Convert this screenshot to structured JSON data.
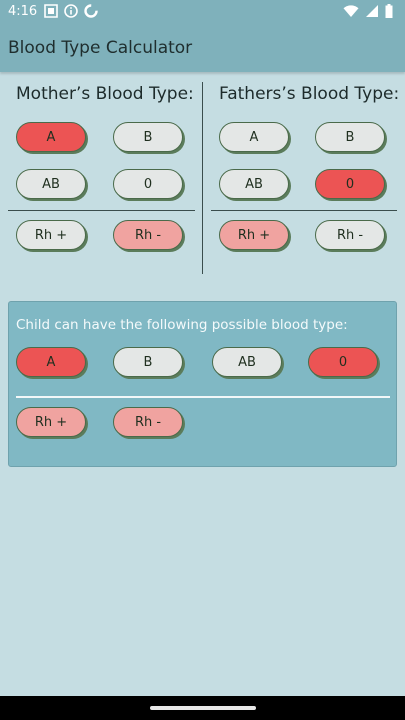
{
  "status_bar": {
    "time": "4:16",
    "icons": [
      "system-icon",
      "info-icon",
      "data-saver-icon",
      "wifi-icon",
      "signal-icon",
      "battery-icon"
    ]
  },
  "app_bar": {
    "title": "Blood Type Calculator"
  },
  "mother": {
    "heading": "Mother’s Blood Type:",
    "types": [
      {
        "label": "A",
        "state": "selected"
      },
      {
        "label": "B",
        "state": "unselected"
      },
      {
        "label": "AB",
        "state": "unselected"
      },
      {
        "label": "0",
        "state": "unselected"
      }
    ],
    "rh": [
      {
        "label": "Rh +",
        "state": "unselected"
      },
      {
        "label": "Rh -",
        "state": "selected"
      }
    ]
  },
  "father": {
    "heading": "Fathers’s Blood Type:",
    "types": [
      {
        "label": "A",
        "state": "unselected"
      },
      {
        "label": "B",
        "state": "unselected"
      },
      {
        "label": "AB",
        "state": "unselected"
      },
      {
        "label": "0",
        "state": "selected"
      }
    ],
    "rh": [
      {
        "label": "Rh +",
        "state": "selected"
      },
      {
        "label": "Rh -",
        "state": "unselected"
      }
    ]
  },
  "result": {
    "label": "Child can have the following possible blood type:",
    "types": [
      {
        "label": "A",
        "state": "possible"
      },
      {
        "label": "B",
        "state": "not-possible"
      },
      {
        "label": "AB",
        "state": "not-possible"
      },
      {
        "label": "0",
        "state": "possible"
      }
    ],
    "rh": [
      {
        "label": "Rh +",
        "state": "possible"
      },
      {
        "label": "Rh -",
        "state": "possible"
      }
    ]
  },
  "colors": {
    "background": "#c5dde2",
    "app_bar": "#7fb1bb",
    "selected_type": "#ec5454",
    "selected_rh": "#f0a3a0",
    "unselected": "#e4e7e6",
    "result_card": "#80b8c4"
  }
}
